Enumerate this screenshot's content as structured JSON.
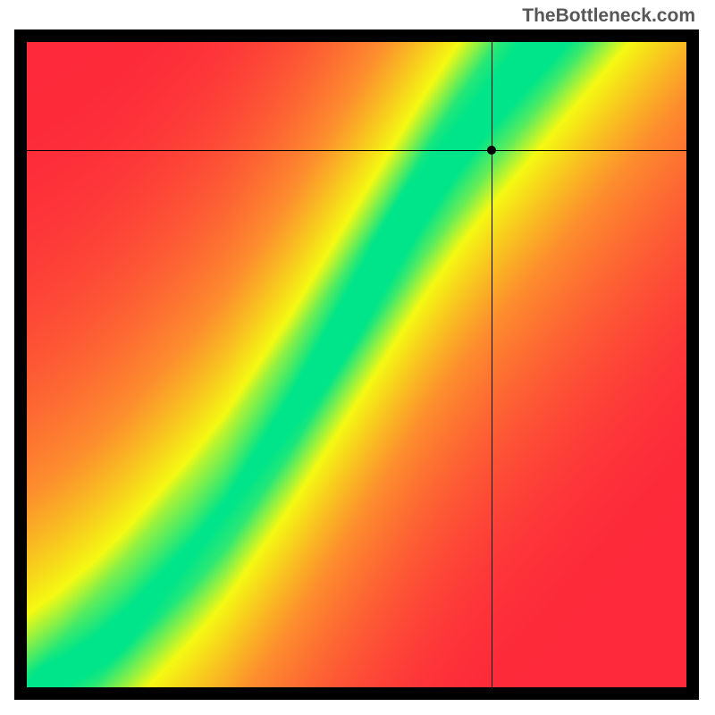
{
  "watermark": "TheBottleneck.com",
  "chart_data": {
    "type": "heatmap",
    "title": "",
    "xlabel": "",
    "ylabel": "",
    "xlim": [
      0,
      1
    ],
    "ylim": [
      0,
      1
    ],
    "marker": {
      "x": 0.705,
      "y": 0.832
    },
    "crosshair": {
      "x": 0.705,
      "y": 0.832
    },
    "optimal_curve": [
      {
        "x": 0.0,
        "y": 0.0
      },
      {
        "x": 0.05,
        "y": 0.02
      },
      {
        "x": 0.1,
        "y": 0.05
      },
      {
        "x": 0.15,
        "y": 0.09
      },
      {
        "x": 0.2,
        "y": 0.14
      },
      {
        "x": 0.25,
        "y": 0.19
      },
      {
        "x": 0.3,
        "y": 0.25
      },
      {
        "x": 0.35,
        "y": 0.33
      },
      {
        "x": 0.4,
        "y": 0.41
      },
      {
        "x": 0.45,
        "y": 0.5
      },
      {
        "x": 0.5,
        "y": 0.59
      },
      {
        "x": 0.55,
        "y": 0.68
      },
      {
        "x": 0.6,
        "y": 0.77
      },
      {
        "x": 0.65,
        "y": 0.85
      },
      {
        "x": 0.7,
        "y": 0.92
      },
      {
        "x": 0.75,
        "y": 0.98
      },
      {
        "x": 0.8,
        "y": 1.04
      }
    ],
    "color_stops": {
      "red": "#fe2a3b",
      "orange": "#fd8f2e",
      "yellow": "#f5fa13",
      "green": "#00e58a"
    },
    "band_width_fraction": 0.06,
    "description": "2D compatibility heatmap. Green diagonal band marks well-balanced pairings; color shifts through yellow and orange to red as the pairing moves away from optimal. A crosshair and dot mark the currently selected combination near the upper band edge."
  }
}
